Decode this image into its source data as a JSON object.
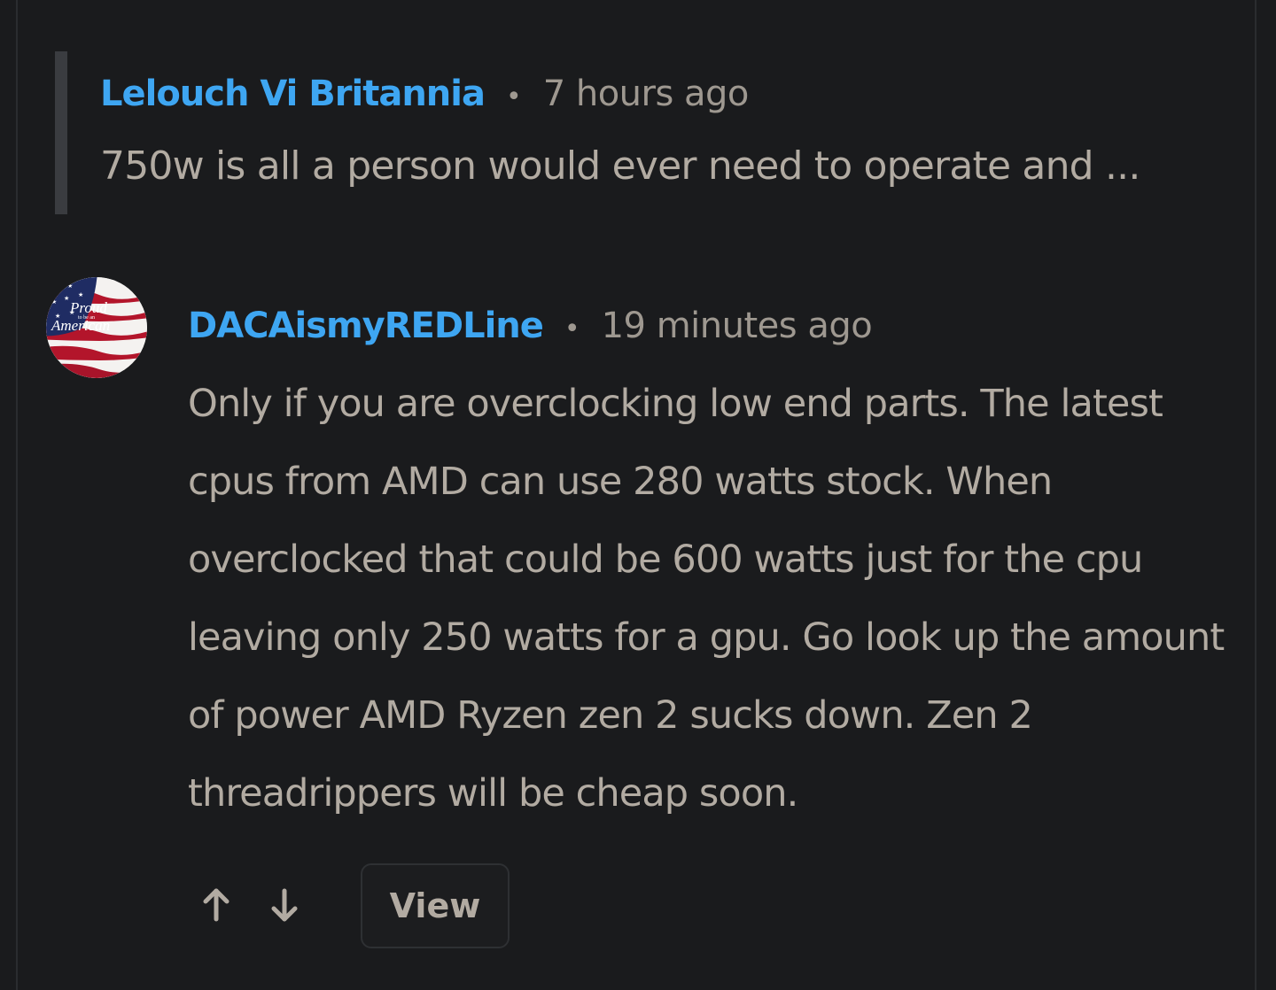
{
  "parent_comment": {
    "author": "Lelouch Vi Britannia",
    "separator": "•",
    "time": "7 hours ago",
    "snippet": "750w is all a person would ever need to operate and ..."
  },
  "comment": {
    "avatar_icon": "american-flag-avatar",
    "author": "DACAismyREDLine",
    "separator": "•",
    "time": "19 minutes ago",
    "body": "Only if you are overclocking low end parts. The latest cpus from AMD can use 280 watts stock. When overclocked that could be 600 watts just for the cpu leaving only 250 watts for a gpu. Go look up the amount of power AMD Ryzen zen 2 sucks down. Zen 2 threadrippers will be cheap soon."
  },
  "actions": {
    "upvote_icon": "arrow-up-icon",
    "downvote_icon": "arrow-down-icon",
    "view_label": "View"
  },
  "colors": {
    "background": "#1a1b1d",
    "author_link": "#3ea6f2",
    "body_text": "#b2aba2",
    "meta_text": "#9e9890",
    "quote_bar": "#3a3c40"
  }
}
